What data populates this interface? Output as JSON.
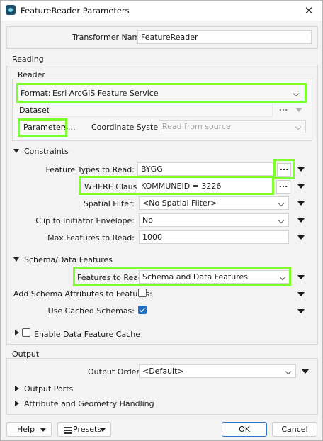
{
  "window": {
    "title": "FeatureReader Parameters"
  },
  "transformer": {
    "label": "Transformer Name:",
    "value": "FeatureReader"
  },
  "reading": {
    "section_label": "Reading",
    "reader_label": "Reader",
    "format_label": "Format:",
    "format_value": "Esri ArcGIS Feature Service",
    "dataset_label": "Dataset:",
    "dataset_button": "...",
    "parameters_button": "Parameters...",
    "coord_label": "Coordinate System:",
    "coord_value": "Read from source"
  },
  "constraints": {
    "section_label": "Constraints",
    "feature_types_label": "Feature Types to Read:",
    "feature_types_value": "BYGG",
    "feature_types_button": "...",
    "where_label": "WHERE Clause:",
    "where_value": "KOMMUNEID = 3226",
    "where_button": "...",
    "spatial_label": "Spatial Filter:",
    "spatial_value": "<No Spatial Filter>",
    "clip_label": "Clip to Initiator Envelope:",
    "clip_value": "No",
    "max_label": "Max Features to Read:",
    "max_value": "1000"
  },
  "schema": {
    "section_label": "Schema/Data Features",
    "features_label": "Features to Read:",
    "features_value": "Schema and Data Features",
    "add_schema_label": "Add Schema Attributes to Features:",
    "add_schema_checked": false,
    "cached_label": "Use Cached Schemas:",
    "cached_checked": true
  },
  "cache": {
    "label": "Enable Data Feature Cache",
    "checked": false
  },
  "output": {
    "section_label": "Output",
    "order_label": "Output Order:",
    "order_value": "<Default>",
    "ports_label": "Output Ports",
    "attr_label": "Attribute and Geometry Handling"
  },
  "footer": {
    "help": "Help",
    "presets": "Presets",
    "ok": "OK",
    "cancel": "Cancel"
  },
  "colors": {
    "highlight": "#7dff2e",
    "accent": "#1f6fc4"
  }
}
